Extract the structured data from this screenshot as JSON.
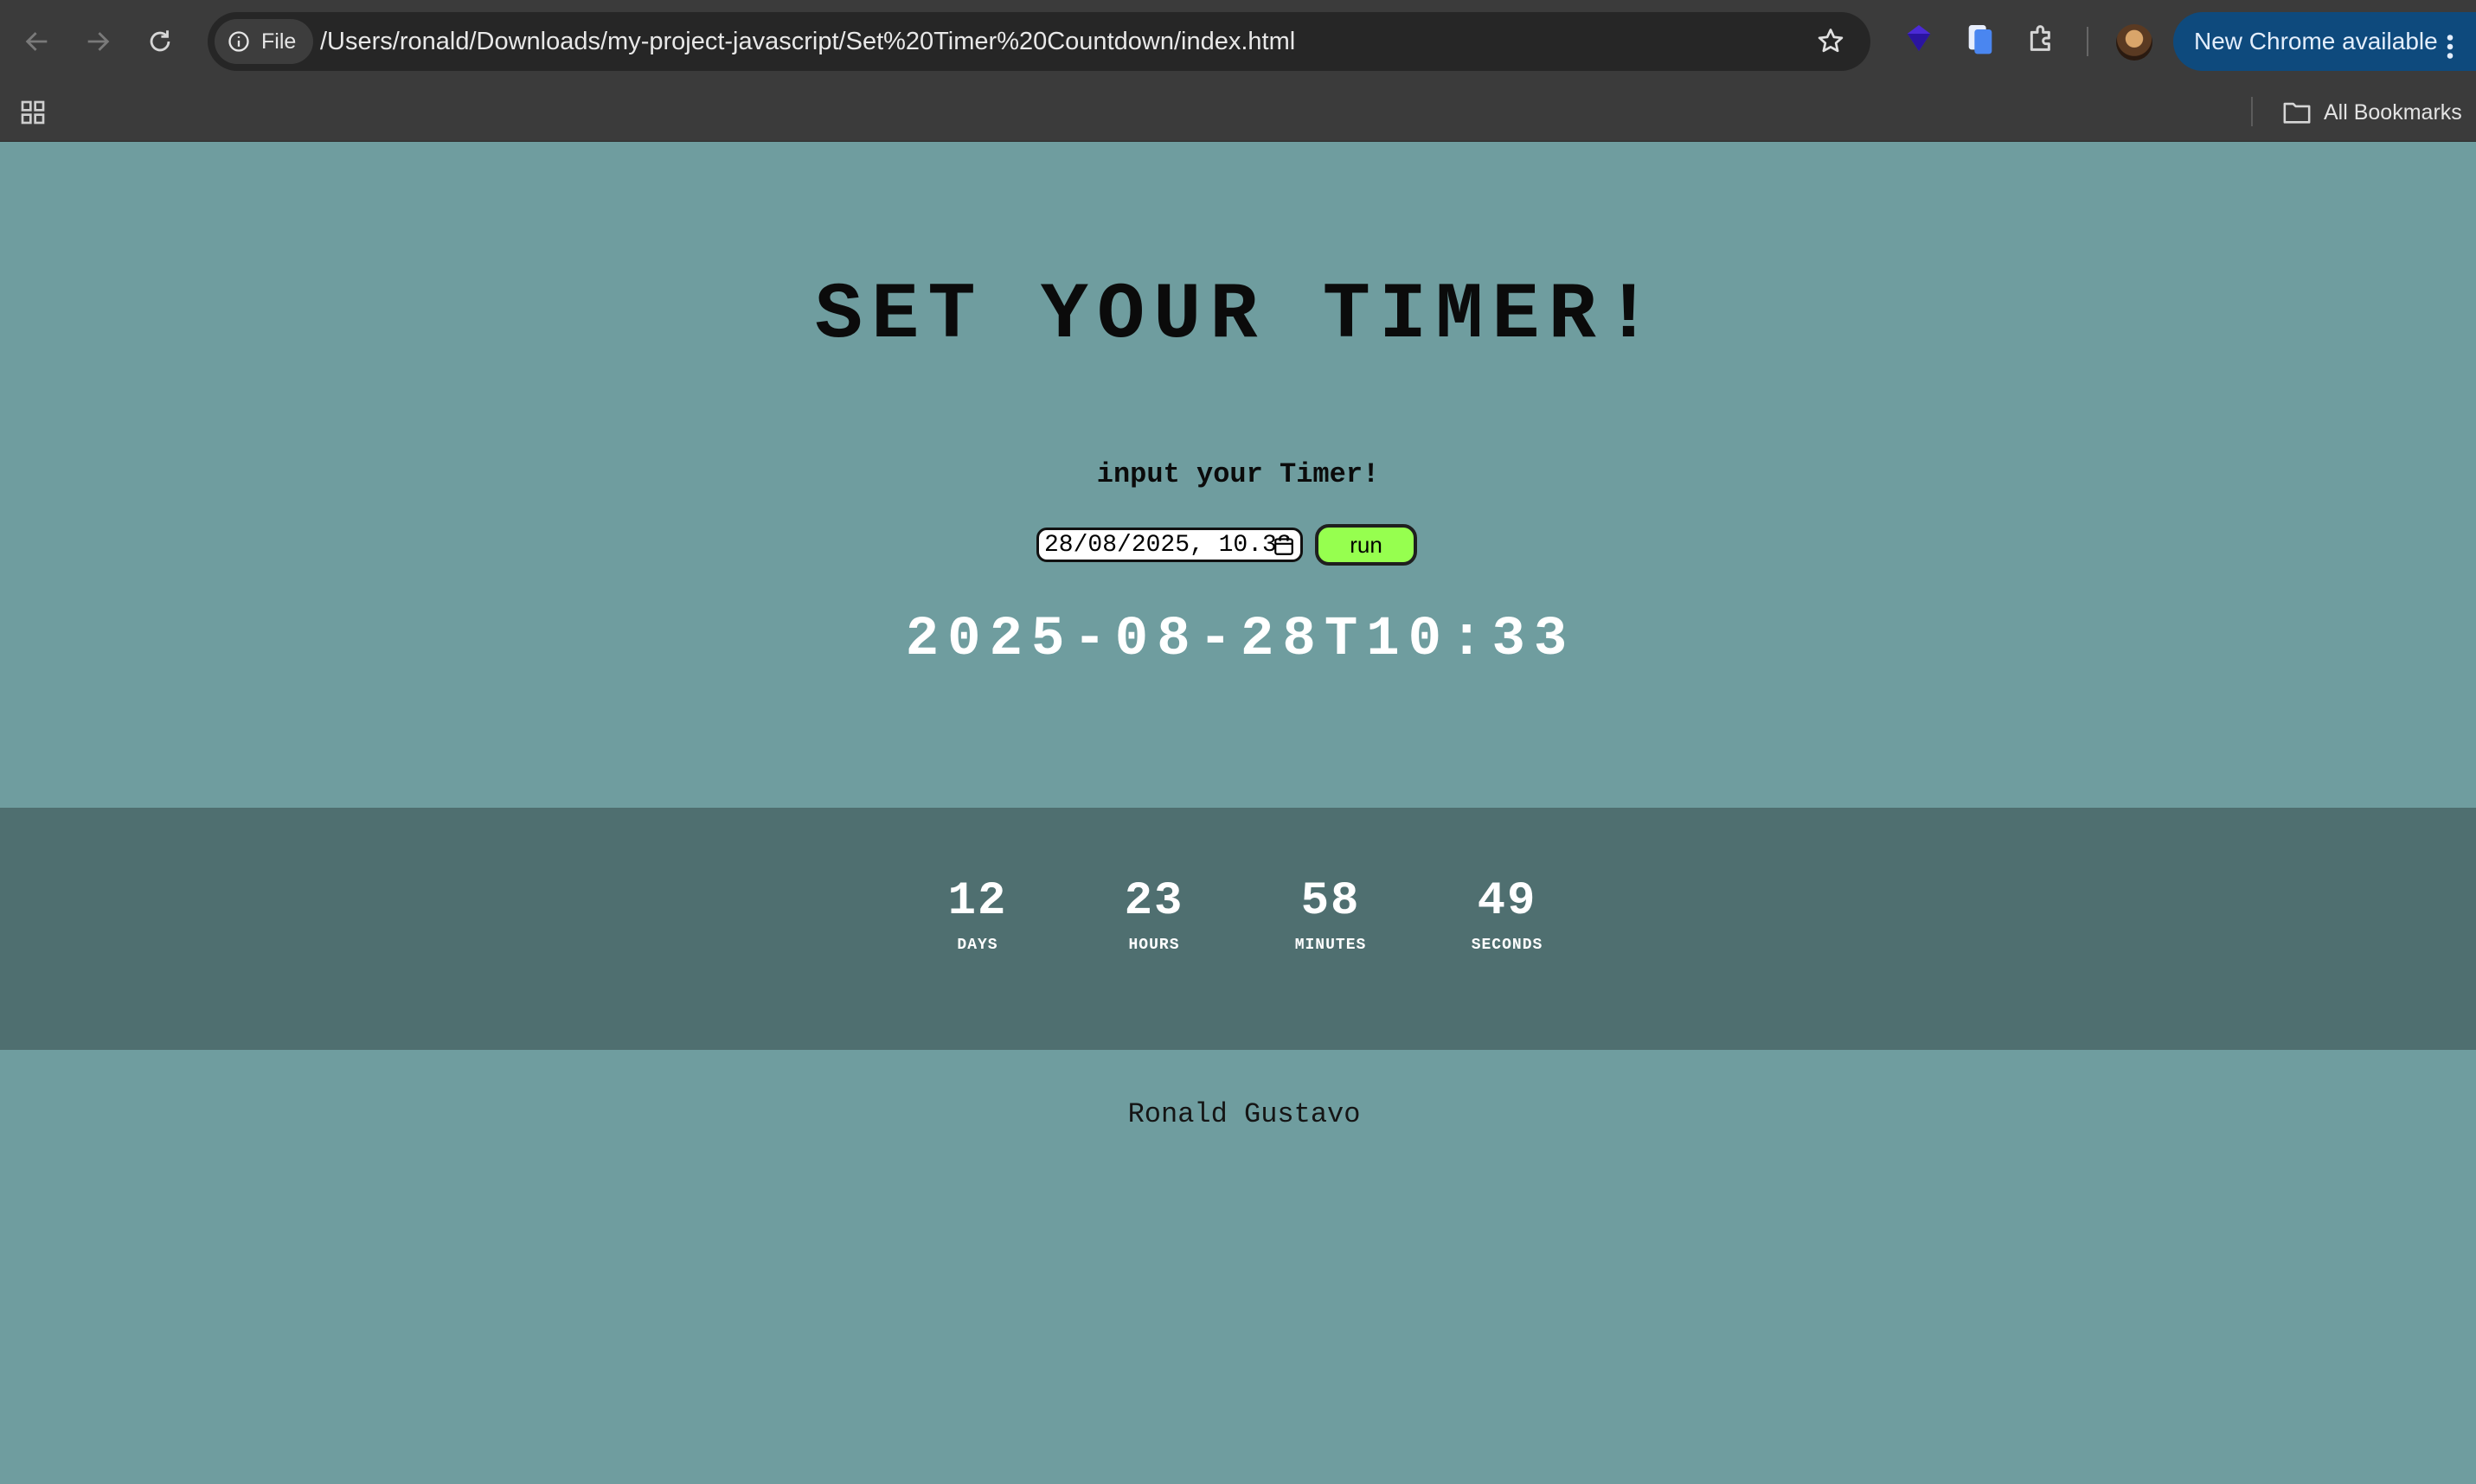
{
  "browser": {
    "address_scheme": "File",
    "url": "/Users/ronald/Downloads/my-project-javascript/Set%20Timer%20Countdown/index.html",
    "update_label": "New Chrome available",
    "bookmarks_label": "All Bookmarks",
    "icons": [
      "back-arrow-icon",
      "forward-arrow-icon",
      "reload-icon",
      "info-icon",
      "star-icon",
      "extension-icon",
      "puzzle-icon",
      "menu-kebab-icon",
      "apps-grid-icon",
      "folder-icon"
    ],
    "colors": {
      "toolbar": "#3b3b3b",
      "omnibox": "#262626",
      "update_pill": "#0e4a7d"
    }
  },
  "page": {
    "title": "SET YOUR TIMER!",
    "subtitle": "input your Timer!",
    "date_input_value": "28/08/2025, 10.33",
    "run_label": "run",
    "target_display": "2025-08-28T10:33",
    "countdown": [
      {
        "value": "12",
        "label": "DAYS"
      },
      {
        "value": "23",
        "label": "HOURS"
      },
      {
        "value": "58",
        "label": "MINUTES"
      },
      {
        "value": "49",
        "label": "SECONDS"
      }
    ],
    "footer": "Ronald Gustavo",
    "colors": {
      "background": "#6f9d9f",
      "band": "#4f6f70",
      "run_button": "#96ff4f"
    }
  }
}
